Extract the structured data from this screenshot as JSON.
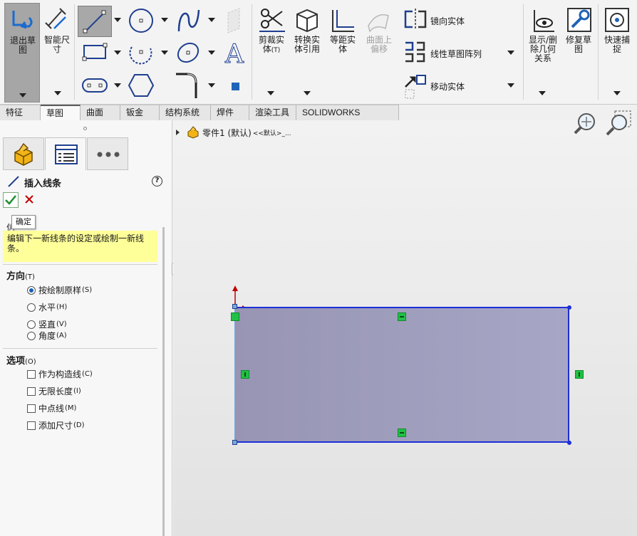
{
  "toolbar": {
    "exit_sketch_label": "退出草图",
    "smart_dim_label": "智能尺寸",
    "trim_label": "剪裁实体",
    "trim_key": "(T)",
    "convert_label": "转换实体引用",
    "offset_label": "等距实体",
    "surface_offset_label": "曲面上偏移",
    "mirror_label": "镜向实体",
    "linear_pattern_label": "线性草图阵列",
    "move_label": "移动实体",
    "show_relations_label": "显示/删除几何关系",
    "repair_label": "修复草图",
    "quick_snap_label": "快速捕捉"
  },
  "tabs": [
    "特征",
    "草图",
    "曲面",
    "钣金",
    "结构系统",
    "焊件",
    "渲染工具",
    "SOLIDWORKS Inspection"
  ],
  "active_tab": "草图",
  "panel": {
    "title": "插入线条",
    "help": "?",
    "ok_tooltip": "确定",
    "message_fragment": "信",
    "message": "编辑下一新线条的设定或绘制一新线条。",
    "direction": {
      "title": "方向",
      "key": "(T)",
      "options": [
        {
          "label": "按绘制原样",
          "key": "(S)",
          "selected": true
        },
        {
          "label": "水平",
          "key": "(H)",
          "selected": false
        },
        {
          "label": "竖直",
          "key": "(V)",
          "selected": false
        },
        {
          "label": "角度",
          "key": "(A)",
          "selected": false
        }
      ]
    },
    "options": {
      "title": "选项",
      "key": "(O)",
      "items": [
        {
          "label": "作为构造线",
          "key": "(C)",
          "checked": false
        },
        {
          "label": "无限长度",
          "key": "(I)",
          "checked": false
        },
        {
          "label": "中点线",
          "key": "(M)",
          "checked": false
        },
        {
          "label": "添加尺寸",
          "key": "(D)",
          "checked": false
        }
      ]
    }
  },
  "tree": {
    "part_name": "零件1 (默认)",
    "suffix": "<<默认>_..."
  },
  "colors": {
    "sketch_line": "#1c2fd8",
    "relation": "#21c046",
    "highlight": "#ffff99"
  }
}
